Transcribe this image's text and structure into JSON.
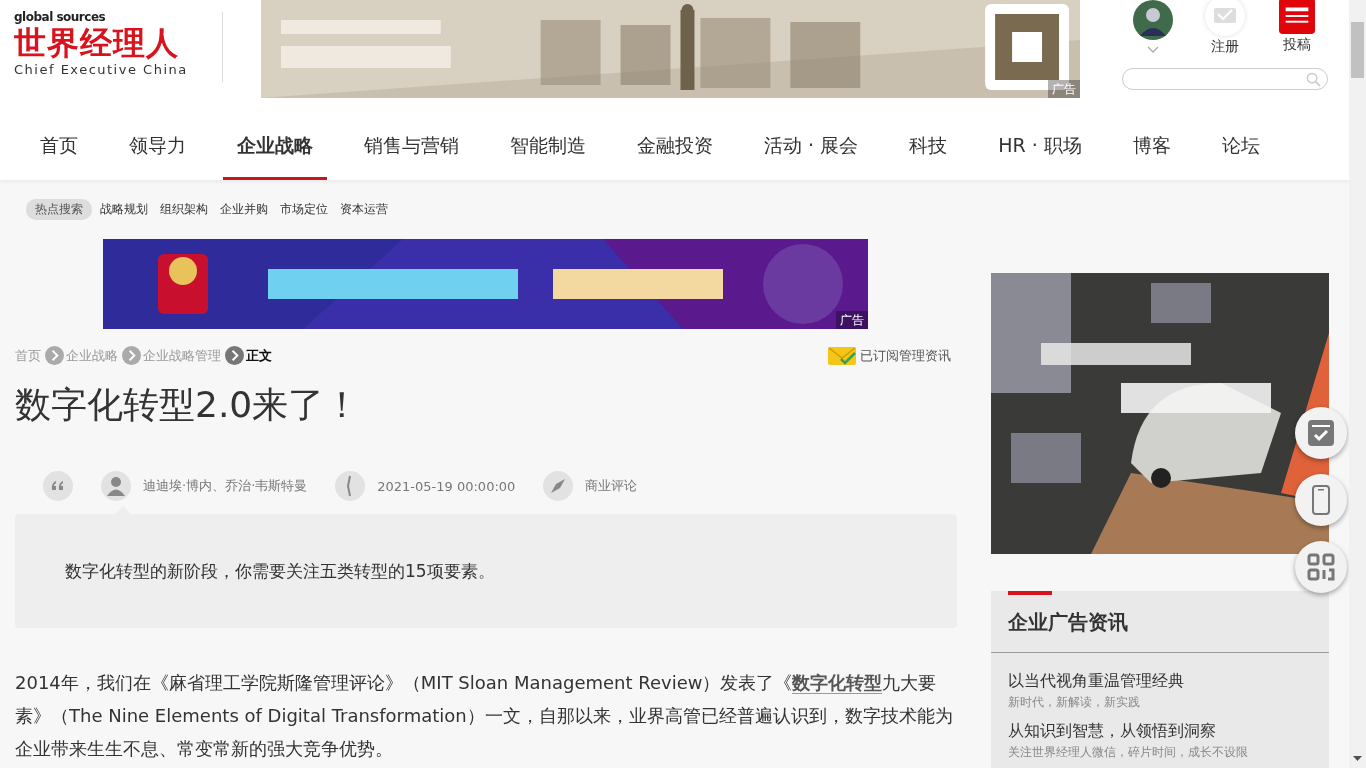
{
  "logo": {
    "top": "global sources",
    "name": "世界经理人",
    "subtitle": "Chief Executive China"
  },
  "header_ad": {
    "tag": "广告"
  },
  "user": {
    "register": "注册",
    "submit": "投稿"
  },
  "nav": [
    {
      "label": "首页",
      "selected": false
    },
    {
      "label": "领导力",
      "selected": false
    },
    {
      "label": "企业战略",
      "selected": true
    },
    {
      "label": "销售与营销",
      "selected": false
    },
    {
      "label": "智能制造",
      "selected": false
    },
    {
      "label": "金融投资",
      "selected": false
    },
    {
      "label": "活动 · 展会",
      "selected": false
    },
    {
      "label": "科技",
      "selected": false
    },
    {
      "label": "HR · 职场",
      "selected": false
    },
    {
      "label": "博客",
      "selected": false
    },
    {
      "label": "论坛",
      "selected": false
    }
  ],
  "hot_search": {
    "label": "热点搜索",
    "tags": [
      "战略规划",
      "组织架构",
      "企业并购",
      "市场定位",
      "资本运营"
    ]
  },
  "banner_ad": {
    "tag": "广告"
  },
  "breadcrumb": [
    {
      "label": "首页",
      "current": false
    },
    {
      "label": "企业战略",
      "current": false
    },
    {
      "label": "企业战略管理",
      "current": false
    },
    {
      "label": "正文",
      "current": true
    }
  ],
  "subscribe": "已订阅管理资讯",
  "article": {
    "title": "数字化转型2.0来了！",
    "author": "迪迪埃·博内、乔治·韦斯特曼",
    "date": "2021-05-19 00:00:00",
    "category": "商业评论",
    "summary": "数字化转型的新阶段，你需要关注五类转型的15项要素。",
    "body_before": "2014年，我们在《麻省理工学院斯隆管理评论》（MIT Sloan Management Review）发表了《",
    "body_link": "数字化转型",
    "body_after": "九大要素》（The Nine Elements of Digital Transformation）一文，自那以来，业界高管已经普遍认识到，数字技术能为企业带来生生不息、常变常新的强大竞争优势。"
  },
  "side_section": {
    "title": "企业广告资讯",
    "items": [
      {
        "title": "以当代视角重温管理经典",
        "subtitle": "新时代，新解读，新实践"
      },
      {
        "title": "从知识到智慧，从领悟到洞察",
        "subtitle": "关注世界经理人微信，碎片时间，成长不设限"
      }
    ]
  }
}
